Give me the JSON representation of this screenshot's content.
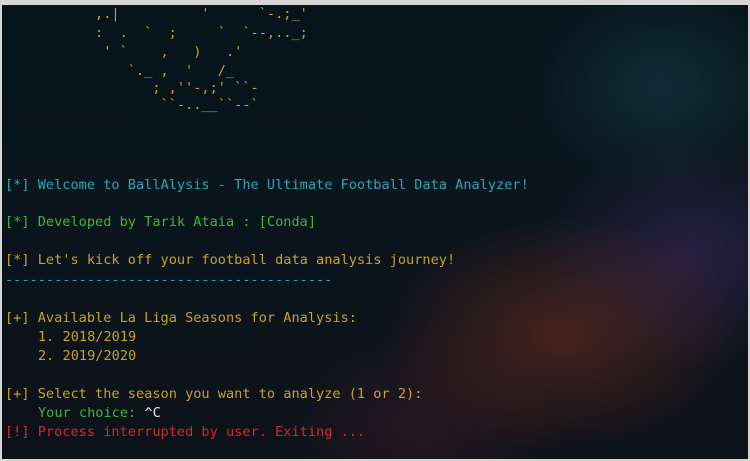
{
  "ascii_art": [
    "           ,.|          '      `-.;_'",
    "           :  .  `  ;     `  `--,.._;",
    "            ' `    ,   )   .'",
    "               `._ ,  '   /_",
    "                  ; ,''-,;' ``-",
    "                   ``-..__``--`"
  ],
  "welcome": {
    "marker": "[*]",
    "text": "Welcome to BallAlysis - The Ultimate Football Data Analyzer!"
  },
  "developer": {
    "marker": "[*]",
    "text": "Developed by Tarik Ataia : [Conda]"
  },
  "kickoff": {
    "marker": "[*]",
    "text": "Let's kick off your football data analysis journey!"
  },
  "separator": "----------------------------------------",
  "seasons": {
    "marker": "[+]",
    "title": "Available La Liga Seasons for Analysis:",
    "items": [
      "1. 2018/2019",
      "2. 2019/2020"
    ]
  },
  "select": {
    "marker": "[+]",
    "text": "Select the season you want to analyze (1 or 2):"
  },
  "choice": {
    "label": "Your choice:",
    "value": "^C"
  },
  "error": {
    "marker": "[!]",
    "text": "Process interrupted by user. Exiting ..."
  },
  "colors": {
    "cyan": "#2aa8b5",
    "green": "#3fb63a",
    "yellow": "#c9a227",
    "red": "#d22a2a"
  }
}
